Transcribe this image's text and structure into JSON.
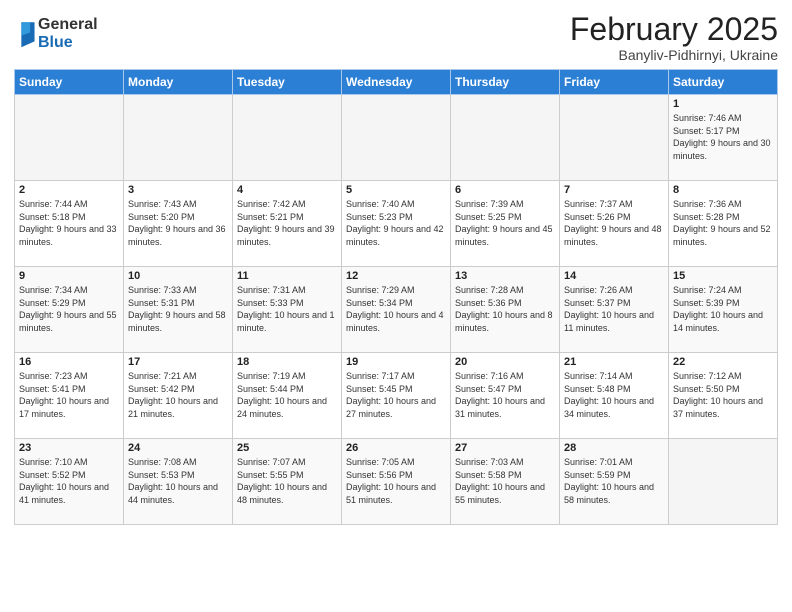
{
  "logo": {
    "general": "General",
    "blue": "Blue"
  },
  "title": "February 2025",
  "subtitle": "Banyliv-Pidhirnyi, Ukraine",
  "weekdays": [
    "Sunday",
    "Monday",
    "Tuesday",
    "Wednesday",
    "Thursday",
    "Friday",
    "Saturday"
  ],
  "weeks": [
    [
      {
        "day": "",
        "info": ""
      },
      {
        "day": "",
        "info": ""
      },
      {
        "day": "",
        "info": ""
      },
      {
        "day": "",
        "info": ""
      },
      {
        "day": "",
        "info": ""
      },
      {
        "day": "",
        "info": ""
      },
      {
        "day": "1",
        "info": "Sunrise: 7:46 AM\nSunset: 5:17 PM\nDaylight: 9 hours and 30 minutes."
      }
    ],
    [
      {
        "day": "2",
        "info": "Sunrise: 7:44 AM\nSunset: 5:18 PM\nDaylight: 9 hours and 33 minutes."
      },
      {
        "day": "3",
        "info": "Sunrise: 7:43 AM\nSunset: 5:20 PM\nDaylight: 9 hours and 36 minutes."
      },
      {
        "day": "4",
        "info": "Sunrise: 7:42 AM\nSunset: 5:21 PM\nDaylight: 9 hours and 39 minutes."
      },
      {
        "day": "5",
        "info": "Sunrise: 7:40 AM\nSunset: 5:23 PM\nDaylight: 9 hours and 42 minutes."
      },
      {
        "day": "6",
        "info": "Sunrise: 7:39 AM\nSunset: 5:25 PM\nDaylight: 9 hours and 45 minutes."
      },
      {
        "day": "7",
        "info": "Sunrise: 7:37 AM\nSunset: 5:26 PM\nDaylight: 9 hours and 48 minutes."
      },
      {
        "day": "8",
        "info": "Sunrise: 7:36 AM\nSunset: 5:28 PM\nDaylight: 9 hours and 52 minutes."
      }
    ],
    [
      {
        "day": "9",
        "info": "Sunrise: 7:34 AM\nSunset: 5:29 PM\nDaylight: 9 hours and 55 minutes."
      },
      {
        "day": "10",
        "info": "Sunrise: 7:33 AM\nSunset: 5:31 PM\nDaylight: 9 hours and 58 minutes."
      },
      {
        "day": "11",
        "info": "Sunrise: 7:31 AM\nSunset: 5:33 PM\nDaylight: 10 hours and 1 minute."
      },
      {
        "day": "12",
        "info": "Sunrise: 7:29 AM\nSunset: 5:34 PM\nDaylight: 10 hours and 4 minutes."
      },
      {
        "day": "13",
        "info": "Sunrise: 7:28 AM\nSunset: 5:36 PM\nDaylight: 10 hours and 8 minutes."
      },
      {
        "day": "14",
        "info": "Sunrise: 7:26 AM\nSunset: 5:37 PM\nDaylight: 10 hours and 11 minutes."
      },
      {
        "day": "15",
        "info": "Sunrise: 7:24 AM\nSunset: 5:39 PM\nDaylight: 10 hours and 14 minutes."
      }
    ],
    [
      {
        "day": "16",
        "info": "Sunrise: 7:23 AM\nSunset: 5:41 PM\nDaylight: 10 hours and 17 minutes."
      },
      {
        "day": "17",
        "info": "Sunrise: 7:21 AM\nSunset: 5:42 PM\nDaylight: 10 hours and 21 minutes."
      },
      {
        "day": "18",
        "info": "Sunrise: 7:19 AM\nSunset: 5:44 PM\nDaylight: 10 hours and 24 minutes."
      },
      {
        "day": "19",
        "info": "Sunrise: 7:17 AM\nSunset: 5:45 PM\nDaylight: 10 hours and 27 minutes."
      },
      {
        "day": "20",
        "info": "Sunrise: 7:16 AM\nSunset: 5:47 PM\nDaylight: 10 hours and 31 minutes."
      },
      {
        "day": "21",
        "info": "Sunrise: 7:14 AM\nSunset: 5:48 PM\nDaylight: 10 hours and 34 minutes."
      },
      {
        "day": "22",
        "info": "Sunrise: 7:12 AM\nSunset: 5:50 PM\nDaylight: 10 hours and 37 minutes."
      }
    ],
    [
      {
        "day": "23",
        "info": "Sunrise: 7:10 AM\nSunset: 5:52 PM\nDaylight: 10 hours and 41 minutes."
      },
      {
        "day": "24",
        "info": "Sunrise: 7:08 AM\nSunset: 5:53 PM\nDaylight: 10 hours and 44 minutes."
      },
      {
        "day": "25",
        "info": "Sunrise: 7:07 AM\nSunset: 5:55 PM\nDaylight: 10 hours and 48 minutes."
      },
      {
        "day": "26",
        "info": "Sunrise: 7:05 AM\nSunset: 5:56 PM\nDaylight: 10 hours and 51 minutes."
      },
      {
        "day": "27",
        "info": "Sunrise: 7:03 AM\nSunset: 5:58 PM\nDaylight: 10 hours and 55 minutes."
      },
      {
        "day": "28",
        "info": "Sunrise: 7:01 AM\nSunset: 5:59 PM\nDaylight: 10 hours and 58 minutes."
      },
      {
        "day": "",
        "info": ""
      }
    ]
  ]
}
